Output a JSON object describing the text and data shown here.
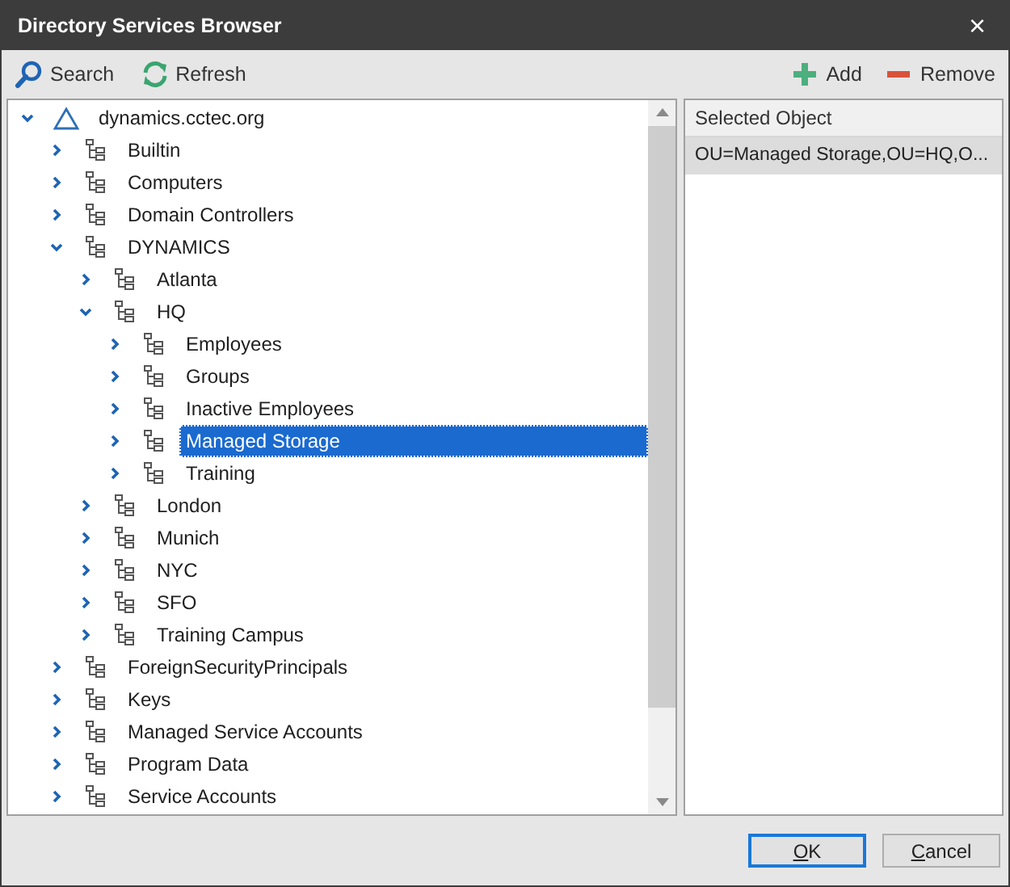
{
  "window": {
    "title": "Directory Services Browser",
    "close": "×"
  },
  "toolbar": {
    "left": [
      {
        "label": "Search",
        "kind": "search"
      },
      {
        "label": "Refresh",
        "kind": "refresh"
      }
    ],
    "right": [
      {
        "label": "Add",
        "kind": "add"
      },
      {
        "label": "Remove",
        "kind": "remove"
      }
    ]
  },
  "tree": [
    {
      "label": "dynamics.cctec.org",
      "kind": "domain",
      "expanded": true,
      "selected": false,
      "children": [
        {
          "label": "Builtin",
          "kind": "ou",
          "expanded": false,
          "selected": false
        },
        {
          "label": "Computers",
          "kind": "ou",
          "expanded": false,
          "selected": false
        },
        {
          "label": "Domain Controllers",
          "kind": "ou",
          "expanded": false,
          "selected": false
        },
        {
          "label": "DYNAMICS",
          "kind": "ou",
          "expanded": true,
          "selected": false,
          "children": [
            {
              "label": "Atlanta",
              "kind": "ou",
              "expanded": false,
              "selected": false
            },
            {
              "label": "HQ",
              "kind": "ou",
              "expanded": true,
              "selected": false,
              "children": [
                {
                  "label": "Employees",
                  "kind": "ou",
                  "expanded": false,
                  "selected": false
                },
                {
                  "label": "Groups",
                  "kind": "ou",
                  "expanded": false,
                  "selected": false
                },
                {
                  "label": "Inactive Employees",
                  "kind": "ou",
                  "expanded": false,
                  "selected": false
                },
                {
                  "label": "Managed Storage",
                  "kind": "ou",
                  "expanded": false,
                  "selected": true
                },
                {
                  "label": "Training",
                  "kind": "ou",
                  "expanded": false,
                  "selected": false
                }
              ]
            },
            {
              "label": "London",
              "kind": "ou",
              "expanded": false,
              "selected": false
            },
            {
              "label": "Munich",
              "kind": "ou",
              "expanded": false,
              "selected": false
            },
            {
              "label": "NYC",
              "kind": "ou",
              "expanded": false,
              "selected": false
            },
            {
              "label": "SFO",
              "kind": "ou",
              "expanded": false,
              "selected": false
            },
            {
              "label": "Training Campus",
              "kind": "ou",
              "expanded": false,
              "selected": false
            }
          ]
        },
        {
          "label": "ForeignSecurityPrincipals",
          "kind": "ou",
          "expanded": false,
          "selected": false
        },
        {
          "label": "Keys",
          "kind": "ou",
          "expanded": false,
          "selected": false
        },
        {
          "label": "Managed Service Accounts",
          "kind": "ou",
          "expanded": false,
          "selected": false
        },
        {
          "label": "Program Data",
          "kind": "ou",
          "expanded": false,
          "selected": false
        },
        {
          "label": "Service Accounts",
          "kind": "ou",
          "expanded": false,
          "selected": false
        }
      ]
    }
  ],
  "selected_objects": {
    "header": "Selected Object",
    "rows": [
      {
        "text": "OU=Managed Storage,OU=HQ,O...",
        "selected": true
      }
    ]
  },
  "buttons": [
    {
      "label": "OK",
      "underline_first": true,
      "default": true
    },
    {
      "label": "Cancel",
      "underline_first": true,
      "default": false
    }
  ]
}
